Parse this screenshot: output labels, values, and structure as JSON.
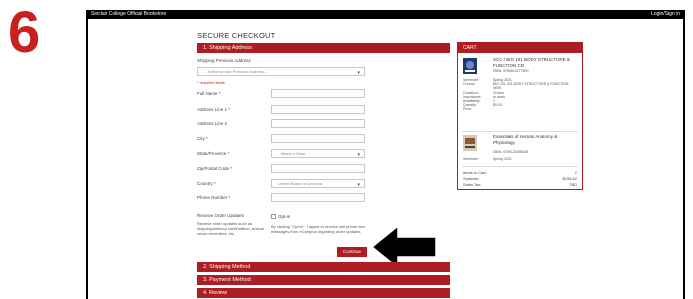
{
  "step_number": "6",
  "topbar": {
    "left": "Sinclair College Official Bookstore",
    "right": "Login/Sign in"
  },
  "page_title": "SECURE CHECKOUT",
  "sections": {
    "shipping_address": "1. Shipping Address",
    "shipping_method": "2. Shipping Method",
    "payment_method": "3. Payment Method",
    "review": "4. Review"
  },
  "form": {
    "shipping_prev_label": "Shipping Previous Address",
    "shipping_prev_placeholder": "-- Select to Use Previous Address --",
    "required_note": "* required fields",
    "full_name_label": "Full Name *",
    "address1_label": "Address Line 1 *",
    "address2_label": "Address Line 2",
    "city_label": "City *",
    "state_label": "State/Province *",
    "state_placeholder": "- Select a State -",
    "zip_label": "Zip/Postal Code *",
    "country_label": "Country *",
    "country_value": "United States of America",
    "phone_label": "Phone Number *",
    "updates_label": "Receive Order Updates",
    "updates_desc": "Receive order updates such as shipping/delivery confirmation, textual return reminders, etc.",
    "optin_label": "Opt-in",
    "optin_desc": "By clicking \"Opt-in\", I agree to receive cell phone text messages from eCampus regarding order updates."
  },
  "continue_label": "Continue",
  "cart": {
    "header": "CART",
    "items": [
      {
        "title": "SCC / BIO 101 BODY STRUCTURE & FUNCTION CD",
        "isbn": "ISBN: 9780814277500",
        "meta_labels": [
          "Semester:",
          "Course:",
          "Condition:",
          "Importance:",
          "Availability:",
          "Quantity:",
          "Price:"
        ],
        "meta_values": [
          "Spring 2021",
          "BIO 101 001 BODY STRUCTURE & FUNCTION",
          "NEW",
          "Choice",
          "In stock",
          "1",
          "$0.00"
        ]
      },
      {
        "title": "Essentials of Human Anatomy & Physiology",
        "isbn": "ISBN: 9780134395326",
        "meta_labels": [
          "Semester:"
        ],
        "meta_values": [
          "Spring 2021"
        ]
      }
    ],
    "totals": {
      "items_label": "Items in Cart:",
      "items_value": "2",
      "subtotal_label": "Subtotal:",
      "subtotal_value": "$156.62",
      "tax_label": "Sales Tax:",
      "tax_value": "TBD"
    }
  },
  "colors": {
    "accent": "#ad1d23",
    "step_number": "#c8201e"
  }
}
